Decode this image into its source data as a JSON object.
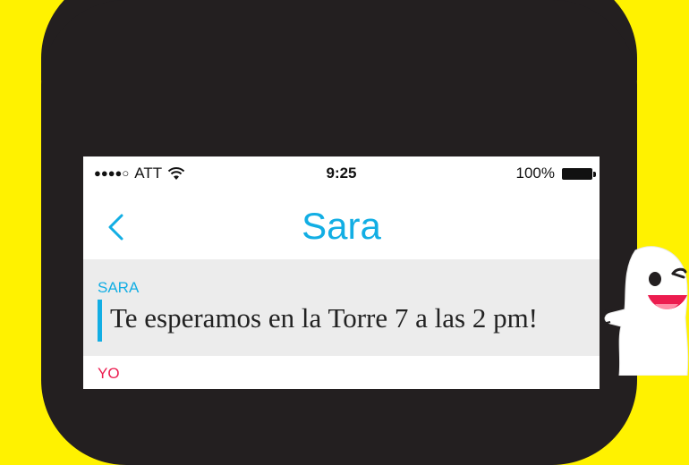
{
  "status_bar": {
    "signal": "●●●●○",
    "carrier": "ATT",
    "time": "9:25",
    "battery_percent": "100%"
  },
  "nav": {
    "title": "Sara"
  },
  "messages": [
    {
      "sender": "SARA",
      "text": "Te esperamos en la Torre 7 a las 2 pm!",
      "color": "#12aee4"
    },
    {
      "sender": "YO",
      "text": "",
      "color": "#ec1c4f"
    }
  ],
  "colors": {
    "background": "#fff200",
    "phone": "#231f20",
    "accent_blue": "#12aee4",
    "accent_red": "#ec1c4f"
  },
  "icons": [
    "wifi-icon",
    "battery-icon",
    "back-chevron-icon",
    "snapchat-ghost-icon"
  ]
}
